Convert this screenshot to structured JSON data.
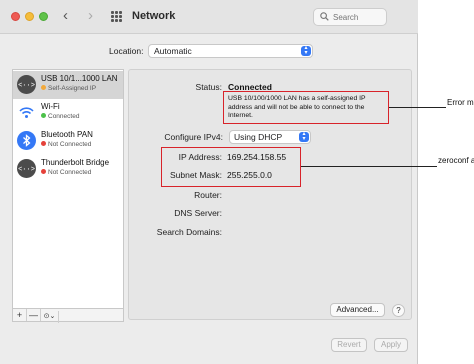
{
  "window": {
    "title": "Network"
  },
  "toolbar": {
    "search_placeholder": "Search"
  },
  "location": {
    "label": "Location:",
    "value": "Automatic"
  },
  "services": [
    {
      "name": "USB 10/1...1000 LAN",
      "status": "Self-Assigned IP",
      "status_color": "#f2a93b",
      "icon": "ethernet-icon",
      "selected": true
    },
    {
      "name": "Wi-Fi",
      "status": "Connected",
      "status_color": "#4cc14a",
      "icon": "wifi-icon",
      "selected": false
    },
    {
      "name": "Bluetooth PAN",
      "status": "Not Connected",
      "status_color": "#e5413a",
      "icon": "bluetooth-icon",
      "selected": false
    },
    {
      "name": "Thunderbolt Bridge",
      "status": "Not Connected",
      "status_color": "#e5413a",
      "icon": "ethernet-icon",
      "selected": false
    }
  ],
  "sidebar_controls": {
    "add": "+",
    "remove": "—",
    "action": "⊙⌄"
  },
  "detail": {
    "status_label": "Status:",
    "status_value": "Connected",
    "status_message": "USB 10/100/1000 LAN has a self-assigned IP address and will not be able to connect to the Internet.",
    "configure_label": "Configure IPv4:",
    "configure_value": "Using DHCP",
    "ip_label": "IP Address:",
    "ip_value": "169.254.158.55",
    "subnet_label": "Subnet Mask:",
    "subnet_value": "255.255.0.0",
    "router_label": "Router:",
    "dns_label": "DNS Server:",
    "search_domains_label": "Search Domains:",
    "advanced_button": "Advanced...",
    "help_button": "?"
  },
  "footer": {
    "revert_button": "Revert",
    "apply_button": "Apply"
  },
  "annotations": {
    "error_callout": "Error message",
    "zeroconf_callout": "zeroconf address",
    "highlight_color": "#d8232a"
  }
}
